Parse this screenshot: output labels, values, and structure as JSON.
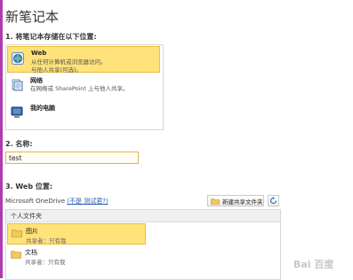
{
  "page": {
    "title": "新笔记本"
  },
  "section1": {
    "label": "1. 将笔记本存储在以下位置:",
    "locations": [
      {
        "name": "Web",
        "desc1": "从任何计算机或浏览器访问。",
        "desc2": "与他人共享(可选)。",
        "icon": "globe-icon",
        "selected": true
      },
      {
        "name": "网络",
        "desc1": "在网络或 SharePoint 上与他人共享。",
        "desc2": "",
        "icon": "network-document-icon",
        "selected": false
      },
      {
        "name": "我的电脑",
        "desc1": "",
        "desc2": "",
        "icon": "computer-icon",
        "selected": false
      }
    ]
  },
  "section2": {
    "label": "2. 名称:",
    "value": "test"
  },
  "section3": {
    "label": "3. Web 位置:",
    "service": "Microsoft OneDrive",
    "switch_account": "(不是 测试君?)",
    "new_folder_label": "新建共享文件夹",
    "header": "个人文件夹",
    "folders": [
      {
        "name": "图片",
        "meta": "共享者：只有我",
        "selected": true
      },
      {
        "name": "文档",
        "meta": "共享者：只有我",
        "selected": false
      }
    ]
  },
  "colors": {
    "selection": "#ffe27a",
    "selection_border": "#eebf33",
    "accent_rule": "#b03bb0"
  }
}
